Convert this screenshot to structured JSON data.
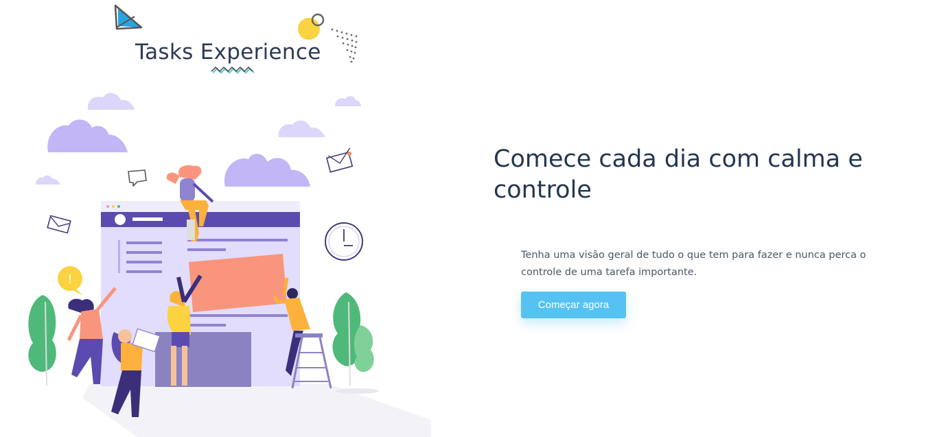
{
  "brand": {
    "title": "Tasks Experience"
  },
  "hero": {
    "headline": "Comece cada dia com calma e controle",
    "description": "Tenha uma visão geral de tudo o que tem para fazer e nunca perca o controle de uma tarefa importante.",
    "cta_label": "Começar agora"
  },
  "illustration": {
    "alert_symbol": "!",
    "icons": [
      "paper-plane-icon",
      "envelope-icon",
      "chat-bubble-icon",
      "clock-icon",
      "alert-icon",
      "cloud-icon",
      "plant-icon"
    ]
  },
  "colors": {
    "headline": "#243650",
    "button": "#56c2f2",
    "accent_purple": "#5b4bb0",
    "cloud": "#c2b6f7",
    "coral": "#f9957d",
    "yellow": "#fbd23f",
    "green": "#4fb97a"
  }
}
